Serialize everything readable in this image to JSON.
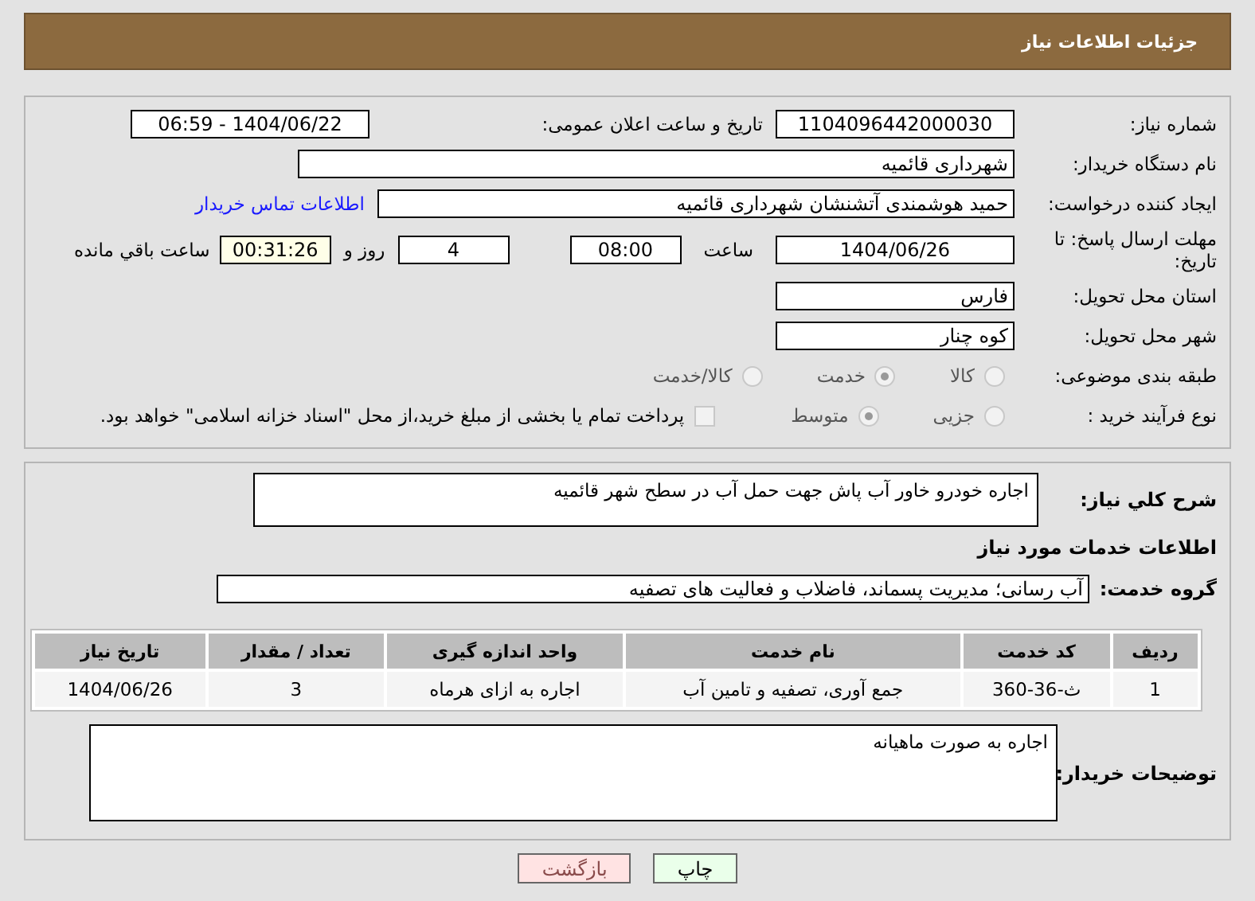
{
  "header": {
    "title": "جزئیات اطلاعات نیاز"
  },
  "need_number": {
    "label": "شماره نیاز:",
    "value": "1104096442000030"
  },
  "announce": {
    "label": "تاریخ و ساعت اعلان عمومی:",
    "value": "1404/06/22 - 06:59"
  },
  "buyer": {
    "label": "نام دستگاه خریدار:",
    "value": "شهرداری قائمیه"
  },
  "creator": {
    "label": "ایجاد کننده درخواست:",
    "value": "حمید هوشمندی آتشنشان شهرداری قائمیه",
    "link": "اطلاعات تماس خریدار"
  },
  "deadline": {
    "label": "مهلت ارسال پاسخ: تا تاریخ:",
    "date": "1404/06/26",
    "time_label": "ساعت",
    "time": "08:00",
    "days": "4",
    "days_label": "روز و",
    "remaining": "00:31:26",
    "remaining_label": "ساعت باقي مانده"
  },
  "province": {
    "label": "استان محل تحویل:",
    "value": "فارس"
  },
  "city": {
    "label": "شهر محل تحویل:",
    "value": "کوه چنار"
  },
  "category": {
    "label": "طبقه بندی موضوعی:",
    "options": [
      {
        "label": "کالا",
        "selected": false
      },
      {
        "label": "خدمت",
        "selected": true
      },
      {
        "label": "کالا/خدمت",
        "selected": false
      }
    ]
  },
  "process": {
    "label": "نوع فرآیند خرید :",
    "options": [
      {
        "label": "جزیی",
        "selected": false
      },
      {
        "label": "متوسط",
        "selected": true
      }
    ],
    "payment": {
      "checked": false,
      "text": "پرداخت تمام یا بخشی از مبلغ خرید،از محل \"اسناد خزانه اسلامی\" خواهد بود."
    }
  },
  "summary": {
    "label": "شرح کلي نياز:",
    "value": "اجاره خودرو خاور آب پاش جهت حمل آب در سطح شهر قائمیه"
  },
  "services_heading": "اطلاعات خدمات مورد نیاز",
  "service_group": {
    "label": "گروه خدمت:",
    "value": "آب رسانی؛ مدیریت پسماند، فاضلاب و فعالیت های تصفیه"
  },
  "table": {
    "columns": [
      "ردیف",
      "کد خدمت",
      "نام خدمت",
      "واحد اندازه گیری",
      "تعداد / مقدار",
      "تاریخ نیاز"
    ],
    "rows": [
      [
        "1",
        "ث-36-360",
        "جمع آوری، تصفیه و تامین آب",
        "اجاره به ازای هرماه",
        "3",
        "1404/06/26"
      ]
    ]
  },
  "buyer_notes": {
    "label": "توضیحات خریدار:",
    "value": "اجاره به صورت ماهیانه"
  },
  "buttons": [
    {
      "label": "چاپ",
      "kind": "print"
    },
    {
      "label": "بازگشت",
      "kind": "back"
    }
  ]
}
